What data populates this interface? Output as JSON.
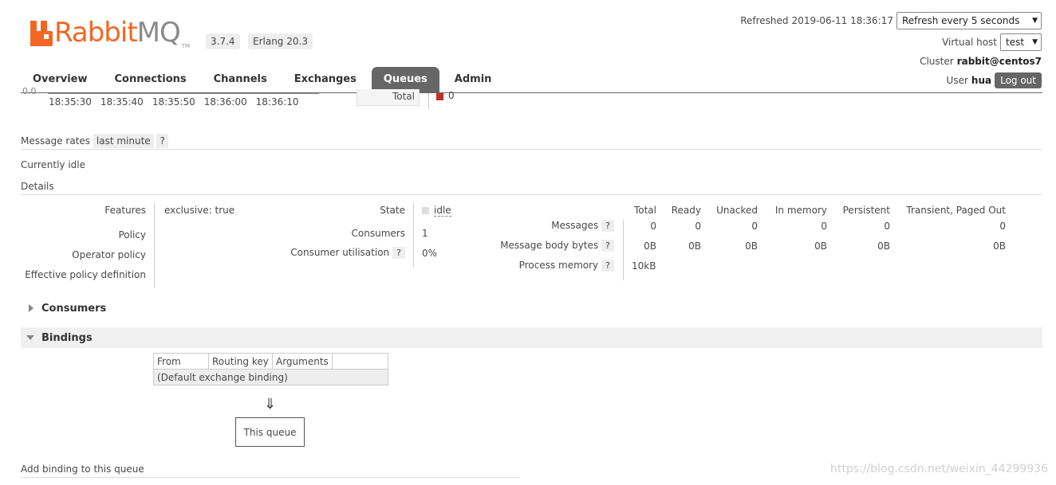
{
  "app": {
    "logo_rabbit": "Rabbit",
    "logo_mq": "MQ",
    "logo_tm": "TM",
    "version": "3.7.4",
    "erlang": "Erlang 20.3",
    "accent_color": "#f26722"
  },
  "header": {
    "refreshed_label": "Refreshed",
    "refreshed_time": "2019-06-11 18:36:17",
    "refresh_select": "Refresh every 5 seconds",
    "vhost_label": "Virtual host",
    "vhost_value": "test",
    "cluster_label": "Cluster",
    "cluster_value": "rabbit@centos7",
    "user_label": "User",
    "user_value": "hua",
    "logout_label": "Log out"
  },
  "tabs": [
    {
      "label": "Overview"
    },
    {
      "label": "Connections"
    },
    {
      "label": "Channels"
    },
    {
      "label": "Exchanges"
    },
    {
      "label": "Queues",
      "active": true
    },
    {
      "label": "Admin"
    }
  ],
  "chart_remnant": {
    "y_zero": "0.0",
    "times": [
      "18:35:30",
      "18:35:40",
      "18:35:50",
      "18:36:00",
      "18:36:10"
    ],
    "total_label": "Total",
    "total_value": "0",
    "series_color": "#c03030"
  },
  "message_rates": {
    "label": "Message rates",
    "range": "last minute",
    "help": "?"
  },
  "idle_text": "Currently idle",
  "details": {
    "title": "Details",
    "features_label": "Features",
    "features_value": "exclusive: true",
    "policy_label": "Policy",
    "operator_policy_label": "Operator policy",
    "effective_policy_label": "Effective policy definition",
    "state_label": "State",
    "state_value": "idle",
    "consumers_label": "Consumers",
    "consumers_value": "1",
    "utilisation_label": "Consumer utilisation",
    "utilisation_value": "0%",
    "help": "?",
    "columns": [
      "Total",
      "Ready",
      "Unacked",
      "In memory",
      "Persistent",
      "Transient, Paged Out"
    ],
    "rows": [
      {
        "label": "Messages",
        "values": [
          "0",
          "0",
          "0",
          "0",
          "0",
          "0"
        ]
      },
      {
        "label": "Message body bytes",
        "values": [
          "0B",
          "0B",
          "0B",
          "0B",
          "0B",
          "0B"
        ]
      },
      {
        "label": "Process memory",
        "values": [
          "10kB"
        ]
      }
    ]
  },
  "consumers_section": "Consumers",
  "bindings_section": "Bindings",
  "bindings_table": {
    "headers": [
      "From",
      "Routing key",
      "Arguments"
    ],
    "default_row": "(Default exchange binding)"
  },
  "bindings_arrow": "⇓",
  "this_queue": "This queue",
  "add_binding": "Add binding to this queue",
  "watermark": "https://blog.csdn.net/weixin_44299936"
}
